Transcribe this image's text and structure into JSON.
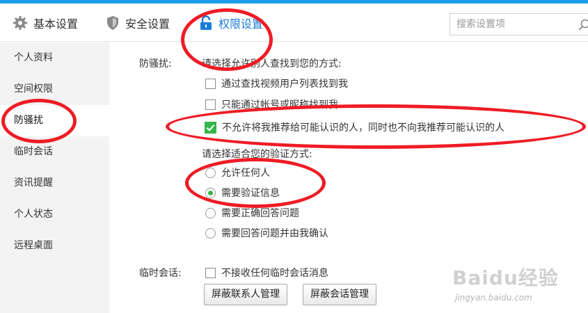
{
  "tabs": [
    {
      "label": "基本设置",
      "icon": "gear-icon",
      "active": false
    },
    {
      "label": "安全设置",
      "icon": "shield-icon",
      "active": false
    },
    {
      "label": "权限设置",
      "icon": "lock-icon",
      "active": true
    }
  ],
  "search": {
    "placeholder": "搜索设置项",
    "value": ""
  },
  "sidebar": {
    "items": [
      {
        "label": "个人资料"
      },
      {
        "label": "空间权限"
      },
      {
        "label": "防骚扰",
        "active": true
      },
      {
        "label": "临时会话"
      },
      {
        "label": "资讯提醒"
      },
      {
        "label": "个人状态"
      },
      {
        "label": "远程桌面"
      }
    ]
  },
  "anti_harass": {
    "label": "防骚扰:",
    "find_prompt": "请选择允许别人查找到您的方式:",
    "find_options": [
      {
        "label": "通过查找视频用户列表找到我",
        "checked": false
      },
      {
        "label": "只能通过帐号或昵称找到我",
        "checked": false
      },
      {
        "label": "不允许将我推荐给可能认识的人，同时也不向我推荐可能认识的人",
        "checked": true
      }
    ],
    "verify_prompt": "请选择适合您的验证方式:",
    "verify_options": [
      {
        "label": "允许任何人",
        "selected": false
      },
      {
        "label": "需要验证信息",
        "selected": true
      },
      {
        "label": "需要正确回答问题",
        "selected": false
      },
      {
        "label": "需要回答问题并由我确认",
        "selected": false
      }
    ]
  },
  "temp_session": {
    "label": "临时会话:",
    "option": {
      "label": "不接收任何临时会话消息",
      "checked": false
    },
    "buttons": [
      {
        "label": "屏蔽联系人管理"
      },
      {
        "label": "屏蔽会话管理"
      }
    ]
  },
  "watermark": {
    "logo": "Baidu经验",
    "url": "jingyan.baidu.com"
  },
  "colors": {
    "accent": "#1a7cd9",
    "top_strip": "#1f9ee8",
    "check_green": "#35b54a",
    "annotation_red": "#ee1c25",
    "sidebar_bg": "#f3f3f3"
  }
}
